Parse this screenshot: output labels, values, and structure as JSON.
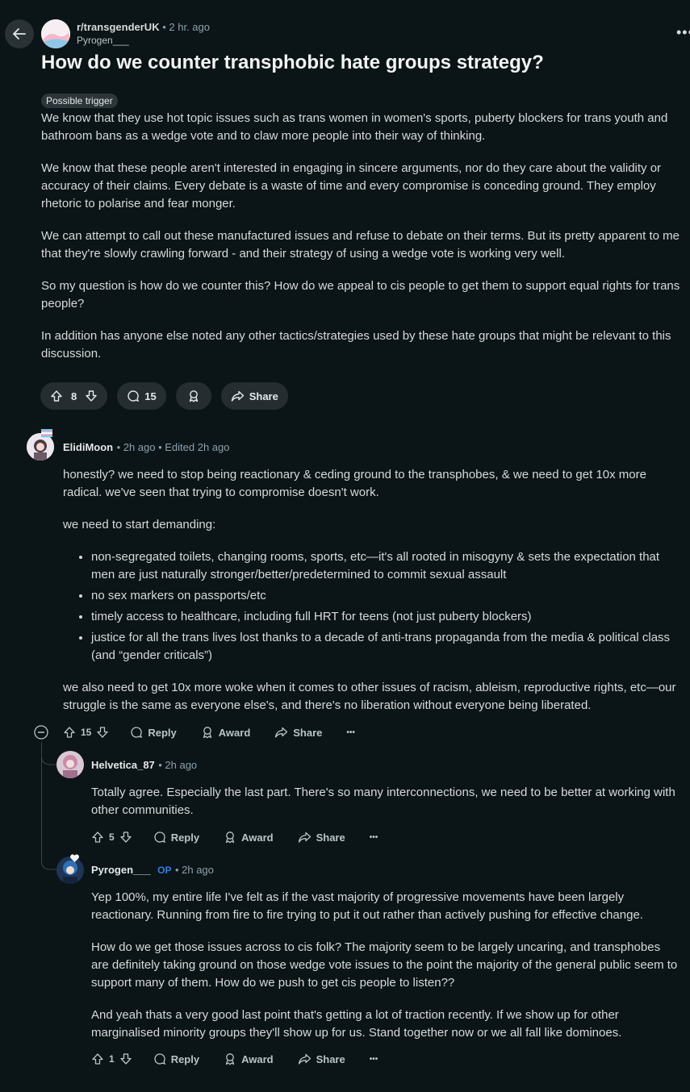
{
  "header": {
    "subreddit": "r/transgenderUK",
    "time": "2 hr. ago",
    "author": "Pyrogen___",
    "more_label": "•••"
  },
  "post": {
    "title": "How do we counter transphobic hate groups strategy?",
    "flair": "Possible trigger",
    "paragraphs": [
      "We know that they use hot topic issues such as trans women in women's sports, puberty blockers for trans youth and bathroom bans as a wedge vote and to claw more people into their way of thinking.",
      "We know that these people aren't interested in engaging in sincere arguments, nor do they care about the validity or accuracy of their claims. Every debate is a waste of time and every compromise is conceding ground. They employ rhetoric to polarise and fear monger.",
      "We can attempt to call out these manufactured issues and refuse to debate on their terms. But its pretty apparent to me that they're slowly crawling forward - and their strategy of using a wedge vote is working very well.",
      "So my question is how do we counter this? How do we appeal to cis people to get them to support equal rights for trans people?",
      "In addition has anyone else noted any other tactics/strategies used by these hate groups that might be relevant to this discussion."
    ],
    "votes": "8",
    "comments": "15",
    "share_label": "Share"
  },
  "comments": [
    {
      "author": "ElidiMoon",
      "meta": "• 2h ago • Edited 2h ago",
      "p1": "honestly? we need to stop being reactionary & ceding ground to the transphobes, & we need to get 10x more radical. we've seen that trying to compromise doesn't work.",
      "p2": "we need to start demanding:",
      "bullets": [
        "non-segregated toilets, changing rooms, sports, etc—it's all rooted in misogyny & sets the expectation that men are just naturally stronger/better/predetermined to commit sexual assault",
        "no sex markers on passports/etc",
        "timely access to healthcare, including full HRT for teens (not just puberty blockers)",
        "justice for all the trans lives lost thanks to a decade of anti-trans propaganda from the media & political class (and “gender criticals”)"
      ],
      "p3": "we also need to get 10x more woke when it comes to other issues of racism, ableism, reproductive rights, etc—our struggle is the same as everyone else's, and there's no liberation without everyone being liberated.",
      "votes": "15",
      "reply": "Reply",
      "award": "Award",
      "share": "Share",
      "more": "•••"
    },
    {
      "author": "Helvetica_87",
      "meta": "• 2h ago",
      "p1": "Totally agree. Especially the last part. There's so many interconnections, we need to be better at working with other communities.",
      "votes": "5",
      "reply": "Reply",
      "award": "Award",
      "share": "Share",
      "more": "•••"
    },
    {
      "author": "Pyrogen___",
      "op": "OP",
      "meta": "• 2h ago",
      "p1": "Yep 100%, my entire life I've felt as if the vast majority of progressive movements have been largely reactionary. Running from fire to fire trying to put it out rather than actively pushing for effective change.",
      "p2": "How do we get those issues across to cis folk? The majority seem to be largely uncaring, and transphobes are definitely taking ground on those wedge vote issues to the point the majority of the general public seem to support many of them. How do we push to get cis people to listen??",
      "p3": "And yeah thats a very good last point that's getting a lot of traction recently. If we show up for other marginalised minority groups they'll show up for us. Stand together now or we all fall like dominoes.",
      "votes": "1",
      "reply": "Reply",
      "award": "Award",
      "share": "Share",
      "more": "•••"
    }
  ]
}
